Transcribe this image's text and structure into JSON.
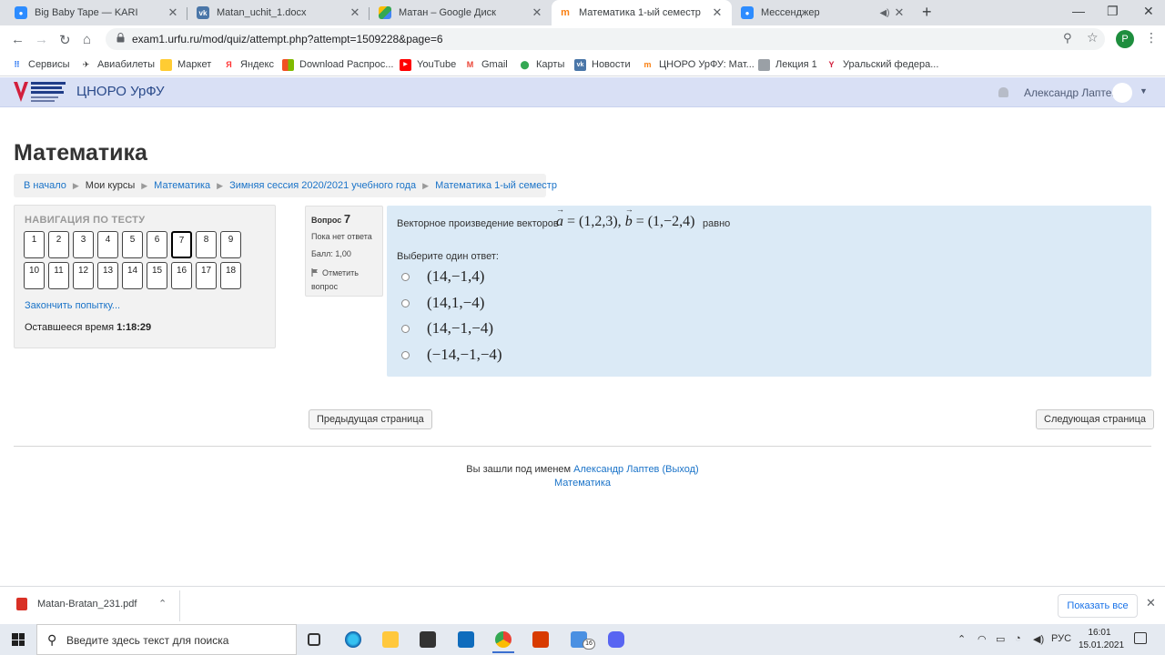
{
  "browser": {
    "tabs": [
      {
        "title": "Big Baby Tape — KARI",
        "icon": "chat-icon"
      },
      {
        "title": "Matan_uchit_1.docx",
        "icon": "vk-icon"
      },
      {
        "title": "Матан – Google Диск",
        "icon": "drive-icon"
      },
      {
        "title": "Математика 1-ый семестр",
        "icon": "moodle-icon"
      },
      {
        "title": "Мессенджер",
        "icon": "chat-icon"
      }
    ],
    "new_tab": "+",
    "url": "exam1.urfu.ru/mod/quiz/attempt.php?attempt=1509228&page=6",
    "profile_letter": "P",
    "bookmarks": [
      "Сервисы",
      "Авиабилеты",
      "Маркет",
      "Яндекс",
      "Download Распрос...",
      "YouTube",
      "Gmail",
      "Карты",
      "Новости",
      "ЦНОРО УрФУ: Мат...",
      "Лекция 1",
      "Уральский федера..."
    ]
  },
  "site": {
    "name": "ЦНОРО УрФУ",
    "user": "Александр Лаптев"
  },
  "page": {
    "title": "Математика",
    "breadcrumb": [
      "В начало",
      "Мои курсы",
      "Математика",
      "Зимняя сессия 2020/2021 учебного года",
      "Математика 1-ый семестр"
    ]
  },
  "quiz_nav": {
    "heading": "НАВИГАЦИЯ ПО ТЕСТУ",
    "row1": [
      "1",
      "2",
      "3",
      "4",
      "5",
      "6",
      "7",
      "8",
      "9"
    ],
    "row2": [
      "10",
      "11",
      "12",
      "13",
      "14",
      "15",
      "16",
      "17",
      "18"
    ],
    "current": "7",
    "finish_label": "Закончить попытку...",
    "time_label": "Оставшееся время",
    "time_value": "1:18:29"
  },
  "question": {
    "label": "Вопрос",
    "number": "7",
    "status": "Пока нет ответа",
    "grade": "Балл: 1,00",
    "flag_label": "Отметить вопрос",
    "text": "Векторное произведение векторов",
    "formula": {
      "a": "a",
      "a_value": "= (1,2,3),",
      "b": "b",
      "b_value": "= (1,−2,4)"
    },
    "text_end": "равно",
    "prompt": "Выберите один ответ:",
    "options": [
      "(14,−1,4)",
      "(14,1,−4)",
      "(14,−1,−4)",
      "(−14,−1,−4)"
    ]
  },
  "buttons": {
    "prev": "Предыдущая страница",
    "next": "Следующая страница"
  },
  "footer": {
    "logged_in": "Вы зашли под именем",
    "user": "Александр Лаптев",
    "logout": "(Выход)",
    "course": "Математика"
  },
  "downloads": {
    "file": "Matan-Bratan_231.pdf",
    "show_all": "Показать все"
  },
  "taskbar": {
    "search_placeholder": "Введите здесь текст для поиска",
    "language": "РУС",
    "time": "16:01",
    "date": "15.01.2021",
    "badge": "16"
  },
  "colors": {
    "header_bg": "#d9e0f5",
    "question_bg": "#dbeaf6",
    "link": "#1a73c8"
  }
}
